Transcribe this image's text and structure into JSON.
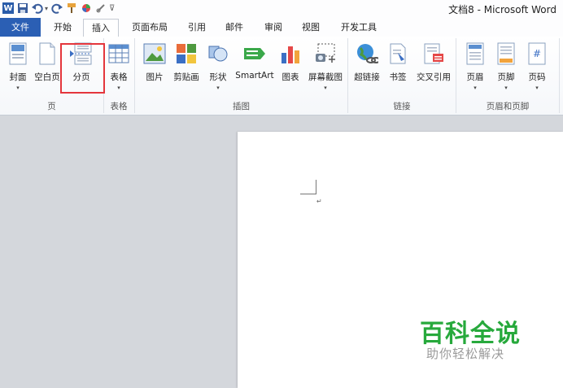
{
  "window": {
    "title": "文档8 - Microsoft Word"
  },
  "quick_access": {
    "icons": [
      "word-app-icon",
      "save-icon",
      "undo-icon",
      "redo-icon",
      "format-painter-icon",
      "color-icon",
      "link-icon",
      "customize-icon"
    ],
    "undo_dropdown": "▾",
    "customize": "⊽"
  },
  "tabs": [
    {
      "label": "文件"
    },
    {
      "label": "开始"
    },
    {
      "label": "插入"
    },
    {
      "label": "页面布局"
    },
    {
      "label": "引用"
    },
    {
      "label": "邮件"
    },
    {
      "label": "审阅"
    },
    {
      "label": "视图"
    },
    {
      "label": "开发工具"
    }
  ],
  "ribbon": {
    "groups": {
      "pages": {
        "label": "页",
        "buttons": [
          {
            "label": "封面",
            "dropdown": "▾"
          },
          {
            "label": "空白页"
          },
          {
            "label": "分页"
          }
        ]
      },
      "tables": {
        "label": "表格",
        "buttons": [
          {
            "label": "表格",
            "dropdown": "▾"
          }
        ]
      },
      "illustrations": {
        "label": "插图",
        "buttons": [
          {
            "label": "图片"
          },
          {
            "label": "剪贴画"
          },
          {
            "label": "形状",
            "dropdown": "▾"
          },
          {
            "label": "SmartArt"
          },
          {
            "label": "图表"
          },
          {
            "label": "屏幕截图",
            "dropdown": "▾"
          }
        ]
      },
      "links": {
        "label": "链接",
        "buttons": [
          {
            "label": "超链接"
          },
          {
            "label": "书签"
          },
          {
            "label": "交叉引用"
          }
        ]
      },
      "header_footer": {
        "label": "页眉和页脚",
        "buttons": [
          {
            "label": "页眉",
            "dropdown": "▾"
          },
          {
            "label": "页脚",
            "dropdown": "▾"
          },
          {
            "label": "页码",
            "dropdown": "▾"
          }
        ]
      }
    }
  },
  "document": {
    "paragraph_mark": "↵"
  },
  "watermark": {
    "title": "百科全说",
    "subtitle": "助你轻松解决"
  },
  "colors": {
    "file_tab": "#2b5fb4",
    "highlight": "#e4363c",
    "watermark_green": "#27a93c"
  }
}
